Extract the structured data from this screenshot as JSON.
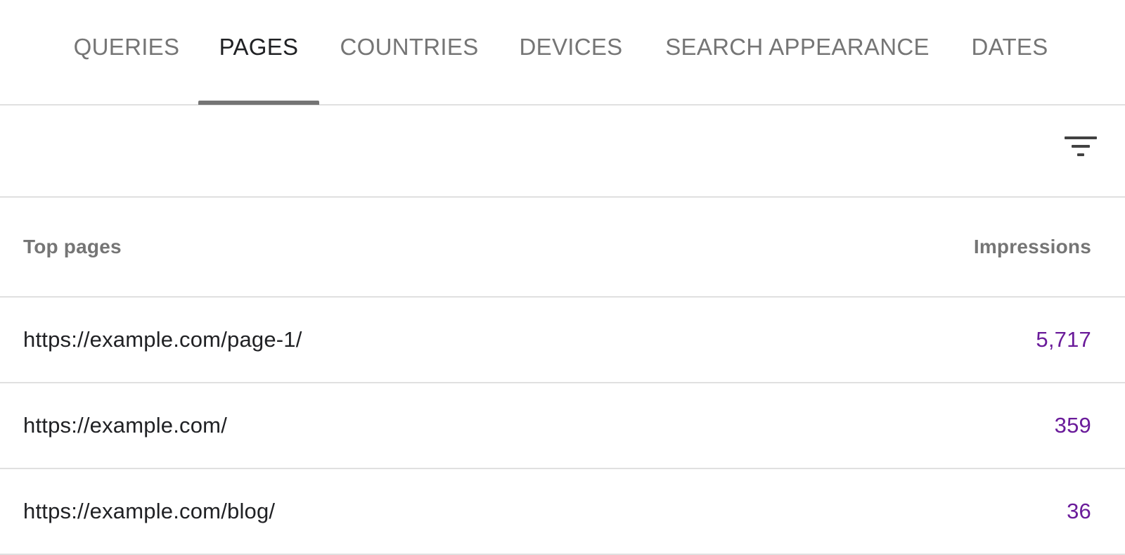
{
  "tabs": [
    {
      "label": "QUERIES",
      "active": false
    },
    {
      "label": "PAGES",
      "active": true
    },
    {
      "label": "COUNTRIES",
      "active": false
    },
    {
      "label": "DEVICES",
      "active": false
    },
    {
      "label": "SEARCH APPEARANCE",
      "active": false
    },
    {
      "label": "DATES",
      "active": false
    }
  ],
  "filter": {
    "icon": "filter-list-icon"
  },
  "table": {
    "headers": {
      "page": "Top pages",
      "metric": "Impressions"
    },
    "rows": [
      {
        "page": "https://example.com/page-1/",
        "impressions": "5,717"
      },
      {
        "page": "https://example.com/",
        "impressions": "359"
      },
      {
        "page": "https://example.com/blog/",
        "impressions": "36"
      }
    ]
  },
  "colors": {
    "active_tab_text": "#202124",
    "inactive_tab_text": "#757575",
    "tab_indicator": "#757575",
    "metric_value": "#6a1b9a",
    "divider": "#e0e0e0"
  }
}
